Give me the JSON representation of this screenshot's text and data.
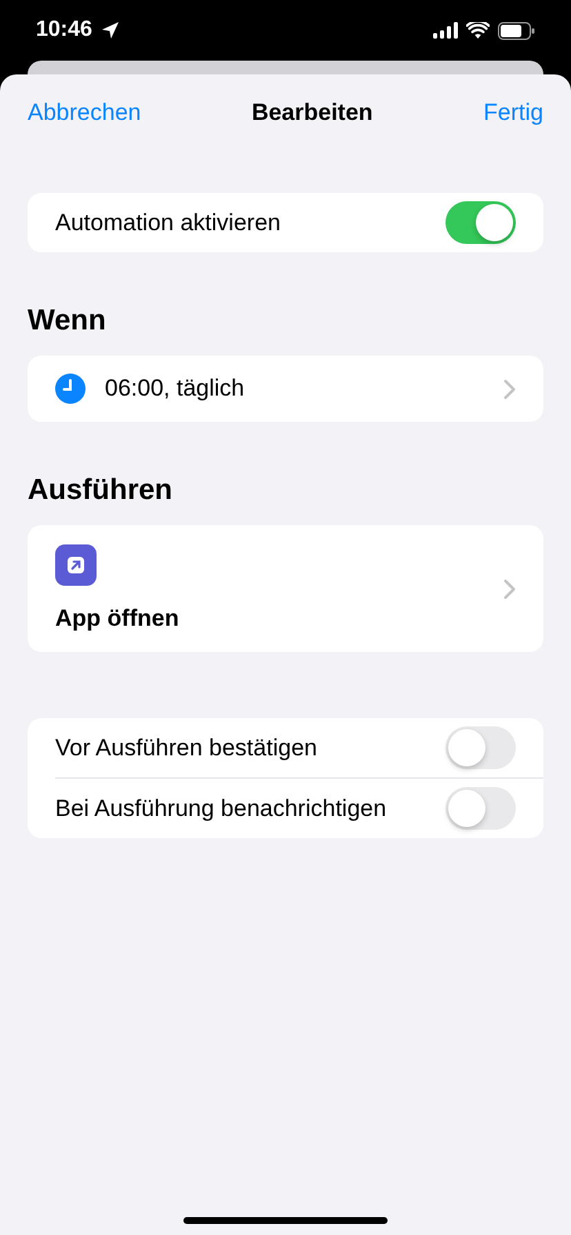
{
  "status_bar": {
    "time": "10:46"
  },
  "nav": {
    "cancel": "Abbrechen",
    "title": "Bearbeiten",
    "done": "Fertig"
  },
  "enable": {
    "label": "Automation aktivieren",
    "on": true
  },
  "when": {
    "heading": "Wenn",
    "trigger": "06:00, täglich"
  },
  "run": {
    "heading": "Ausführen",
    "action": "App öffnen"
  },
  "options": [
    {
      "label": "Vor Ausführen bestätigen",
      "on": false
    },
    {
      "label": "Bei Ausführung benachrichtigen",
      "on": false
    }
  ]
}
